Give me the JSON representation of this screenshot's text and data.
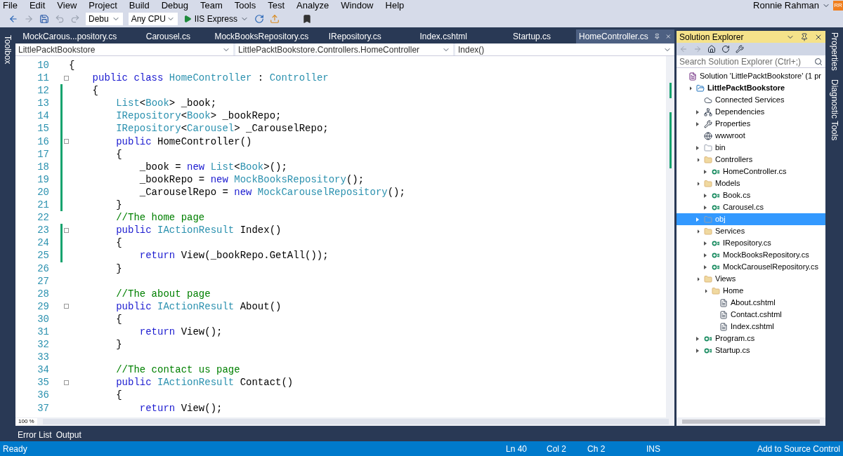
{
  "menu": [
    "File",
    "Edit",
    "View",
    "Project",
    "Build",
    "Debug",
    "Team",
    "Tools",
    "Test",
    "Analyze",
    "Window",
    "Help"
  ],
  "user": {
    "name": "Ronnie Rahman",
    "initials": "RR"
  },
  "toolbar": {
    "configuration": "Debu",
    "platform": "Any CPU",
    "run": "IIS Express"
  },
  "left_strip": "Toolbox",
  "right_strip": [
    "Properties",
    "Diagnostic Tools"
  ],
  "tabs": [
    {
      "label": "MockCarous...pository.cs",
      "selected": false
    },
    {
      "label": "Carousel.cs",
      "selected": false
    },
    {
      "label": "MockBooksRepository.cs",
      "selected": false
    },
    {
      "label": "IRepository.cs",
      "selected": false
    },
    {
      "label": "Index.cshtml",
      "selected": false
    },
    {
      "label": "Startup.cs",
      "selected": false
    },
    {
      "label": "HomeController.cs",
      "selected": true
    }
  ],
  "nav_bar": [
    "LittlePacktBookstore",
    "LittlePacktBookstore.Controllers.HomeController",
    "Index()"
  ],
  "code_lines": [
    {
      "number": "10",
      "changed": false,
      "foldable": false,
      "tokens": [
        {
          "kind": "plain",
          "text": "{"
        }
      ]
    },
    {
      "number": "11",
      "changed": false,
      "foldable": true,
      "tokens": [
        {
          "kind": "keyword",
          "text": "    public class "
        },
        {
          "kind": "type",
          "text": "HomeController"
        },
        {
          "kind": "plain",
          "text": " : "
        },
        {
          "kind": "type",
          "text": "Controller"
        }
      ]
    },
    {
      "number": "12",
      "changed": true,
      "foldable": false,
      "tokens": [
        {
          "kind": "plain",
          "text": "    {"
        }
      ]
    },
    {
      "number": "13",
      "changed": true,
      "foldable": false,
      "tokens": [
        {
          "kind": "type",
          "text": "        List"
        },
        {
          "kind": "plain",
          "text": "<"
        },
        {
          "kind": "type",
          "text": "Book"
        },
        {
          "kind": "plain",
          "text": "> _book;"
        }
      ]
    },
    {
      "number": "14",
      "changed": true,
      "foldable": false,
      "tokens": [
        {
          "kind": "type",
          "text": "        IRepository"
        },
        {
          "kind": "plain",
          "text": "<"
        },
        {
          "kind": "type",
          "text": "Book"
        },
        {
          "kind": "plain",
          "text": "> _bookRepo;"
        }
      ]
    },
    {
      "number": "15",
      "changed": true,
      "foldable": false,
      "tokens": [
        {
          "kind": "type",
          "text": "        IRepository"
        },
        {
          "kind": "plain",
          "text": "<"
        },
        {
          "kind": "type",
          "text": "Carousel"
        },
        {
          "kind": "plain",
          "text": "> _CarouselRepo;"
        }
      ]
    },
    {
      "number": "16",
      "changed": true,
      "foldable": true,
      "tokens": [
        {
          "kind": "keyword",
          "text": "        public "
        },
        {
          "kind": "plain",
          "text": "HomeController()"
        }
      ]
    },
    {
      "number": "17",
      "changed": true,
      "foldable": false,
      "tokens": [
        {
          "kind": "plain",
          "text": "        {"
        }
      ]
    },
    {
      "number": "18",
      "changed": true,
      "foldable": false,
      "tokens": [
        {
          "kind": "plain",
          "text": "            _book = "
        },
        {
          "kind": "keyword",
          "text": "new "
        },
        {
          "kind": "type",
          "text": "List"
        },
        {
          "kind": "plain",
          "text": "<"
        },
        {
          "kind": "type",
          "text": "Book"
        },
        {
          "kind": "plain",
          "text": ">();"
        }
      ]
    },
    {
      "number": "19",
      "changed": true,
      "foldable": false,
      "tokens": [
        {
          "kind": "plain",
          "text": "            _bookRepo = "
        },
        {
          "kind": "keyword",
          "text": "new "
        },
        {
          "kind": "type",
          "text": "MockBooksRepository"
        },
        {
          "kind": "plain",
          "text": "();"
        }
      ]
    },
    {
      "number": "20",
      "changed": true,
      "foldable": false,
      "tokens": [
        {
          "kind": "plain",
          "text": "            _CarouselRepo = "
        },
        {
          "kind": "keyword",
          "text": "new "
        },
        {
          "kind": "type",
          "text": "MockCarouselRepository"
        },
        {
          "kind": "plain",
          "text": "();"
        }
      ]
    },
    {
      "number": "21",
      "changed": true,
      "foldable": false,
      "tokens": [
        {
          "kind": "plain",
          "text": "        }"
        }
      ]
    },
    {
      "number": "22",
      "changed": false,
      "foldable": false,
      "tokens": [
        {
          "kind": "comment",
          "text": "        //The home page"
        }
      ]
    },
    {
      "number": "23",
      "changed": true,
      "foldable": true,
      "tokens": [
        {
          "kind": "keyword",
          "text": "        public "
        },
        {
          "kind": "type",
          "text": "IActionResult"
        },
        {
          "kind": "plain",
          "text": " Index()"
        }
      ]
    },
    {
      "number": "24",
      "changed": true,
      "foldable": false,
      "tokens": [
        {
          "kind": "plain",
          "text": "        {"
        }
      ]
    },
    {
      "number": "25",
      "changed": true,
      "foldable": false,
      "tokens": [
        {
          "kind": "keyword",
          "text": "            return "
        },
        {
          "kind": "plain",
          "text": "View(_bookRepo.GetAll());"
        }
      ]
    },
    {
      "number": "26",
      "changed": false,
      "foldable": false,
      "tokens": [
        {
          "kind": "plain",
          "text": "        }"
        }
      ]
    },
    {
      "number": "27",
      "changed": false,
      "foldable": false
    },
    {
      "number": "28",
      "changed": false,
      "foldable": false,
      "tokens": [
        {
          "kind": "comment",
          "text": "        //The about page"
        }
      ]
    },
    {
      "number": "29",
      "changed": false,
      "foldable": true,
      "tokens": [
        {
          "kind": "keyword",
          "text": "        public "
        },
        {
          "kind": "type",
          "text": "IActionResult"
        },
        {
          "kind": "plain",
          "text": " About()"
        }
      ]
    },
    {
      "number": "30",
      "changed": false,
      "foldable": false,
      "tokens": [
        {
          "kind": "plain",
          "text": "        {"
        }
      ]
    },
    {
      "number": "31",
      "changed": false,
      "foldable": false,
      "tokens": [
        {
          "kind": "keyword",
          "text": "            return "
        },
        {
          "kind": "plain",
          "text": "View();"
        }
      ]
    },
    {
      "number": "32",
      "changed": false,
      "foldable": false,
      "tokens": [
        {
          "kind": "plain",
          "text": "        }"
        }
      ]
    },
    {
      "number": "33",
      "changed": false,
      "foldable": false
    },
    {
      "number": "34",
      "changed": false,
      "foldable": false,
      "tokens": [
        {
          "kind": "comment",
          "text": "        //The contact us page"
        }
      ]
    },
    {
      "number": "35",
      "changed": false,
      "foldable": true,
      "tokens": [
        {
          "kind": "keyword",
          "text": "        public "
        },
        {
          "kind": "type",
          "text": "IActionResult"
        },
        {
          "kind": "plain",
          "text": " Contact()"
        }
      ]
    },
    {
      "number": "36",
      "changed": false,
      "foldable": false,
      "tokens": [
        {
          "kind": "plain",
          "text": "        {"
        }
      ]
    },
    {
      "number": "37",
      "changed": false,
      "foldable": false,
      "tokens": [
        {
          "kind": "keyword",
          "text": "            return "
        },
        {
          "kind": "plain",
          "text": "View();"
        }
      ]
    }
  ],
  "zoom": "100 %",
  "bottom_tabs": [
    "Error List",
    "Output"
  ],
  "solution_explorer": {
    "title": "Solution Explorer",
    "search": {
      "placeholder": "Search Solution Explorer (Ctrl+;)"
    },
    "tree": [
      {
        "label": "Solution 'LittlePacktBookstore' (1 pr",
        "kind": "solution",
        "selected": false,
        "children": [
          {
            "label": "LittlePacktBookstore",
            "kind": "project",
            "expanded": true,
            "selected": false,
            "children": [
              {
                "label": "Connected Services",
                "kind": "service",
                "selected": false
              },
              {
                "label": "Dependencies",
                "kind": "dependencies",
                "expanded": false,
                "selected": false
              },
              {
                "label": "Properties",
                "kind": "properties",
                "expanded": false,
                "selected": false
              },
              {
                "label": "wwwroot",
                "kind": "web",
                "selected": false
              },
              {
                "label": "bin",
                "kind": "hidden-folder",
                "expanded": false,
                "selected": false
              },
              {
                "label": "Controllers",
                "kind": "folder",
                "expanded": true,
                "selected": false,
                "children": [
                  {
                    "label": "HomeController.cs",
                    "kind": "csfile",
                    "expanded": false,
                    "selected": false
                  }
                ]
              },
              {
                "label": "Models",
                "kind": "folder",
                "expanded": true,
                "selected": false,
                "children": [
                  {
                    "label": "Book.cs",
                    "kind": "csfile",
                    "expanded": false,
                    "selected": false
                  },
                  {
                    "label": "Carousel.cs",
                    "kind": "csfile",
                    "expanded": false,
                    "selected": false
                  }
                ]
              },
              {
                "label": "obj",
                "kind": "hidden-folder",
                "expanded": false,
                "selected": true
              },
              {
                "label": "Services",
                "kind": "folder",
                "expanded": true,
                "selected": false,
                "children": [
                  {
                    "label": "IRepository.cs",
                    "kind": "csfile",
                    "expanded": false,
                    "selected": false
                  },
                  {
                    "label": "MockBooksRepository.cs",
                    "kind": "csfile",
                    "expanded": false,
                    "selected": false
                  },
                  {
                    "label": "MockCarouselRepository.cs",
                    "kind": "csfile",
                    "expanded": false,
                    "selected": false
                  }
                ]
              },
              {
                "label": "Views",
                "kind": "folder",
                "expanded": true,
                "selected": false,
                "children": [
                  {
                    "label": "Home",
                    "kind": "folder",
                    "expanded": true,
                    "selected": false,
                    "children": [
                      {
                        "label": "About.cshtml",
                        "kind": "page",
                        "selected": false
                      },
                      {
                        "label": "Contact.cshtml",
                        "kind": "page",
                        "selected": false
                      },
                      {
                        "label": "Index.cshtml",
                        "kind": "page",
                        "selected": false
                      }
                    ]
                  }
                ]
              },
              {
                "label": "Program.cs",
                "kind": "csfile",
                "expanded": false,
                "selected": false
              },
              {
                "label": "Startup.cs",
                "kind": "csfile",
                "expanded": false,
                "selected": false
              }
            ]
          }
        ]
      }
    ]
  },
  "status_bar": {
    "message": "Ready",
    "line": "Ln 40",
    "column": "Col 2",
    "char": "Ch 2",
    "mode": "INS",
    "source_control": "Add to Source Control"
  }
}
